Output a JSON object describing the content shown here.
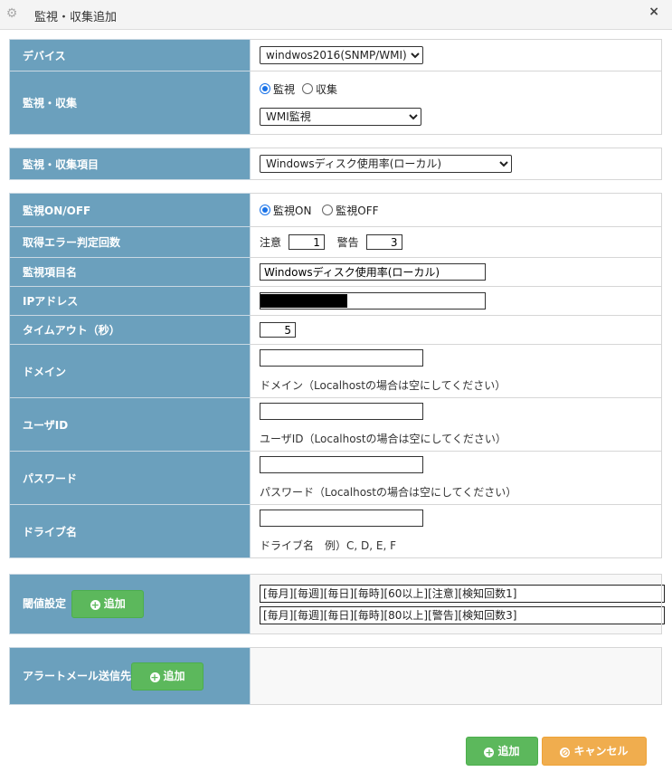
{
  "window": {
    "title": "監視・収集追加",
    "close": "×"
  },
  "device": {
    "label": "デバイス",
    "value": "windwos2016(SNMP/WMI)"
  },
  "monitor_collect": {
    "label": "監視・収集",
    "radio_monitor": "監視",
    "radio_collect": "収集",
    "method": "WMI監視"
  },
  "item": {
    "label": "監視・収集項目",
    "value": "Windowsディスク使用率(ローカル)"
  },
  "onoff": {
    "label": "監視ON/OFF",
    "on": "監視ON",
    "off": "監視OFF"
  },
  "error_count": {
    "label": "取得エラー判定回数",
    "caution_label": "注意",
    "caution_value": "1",
    "warning_label": "警告",
    "warning_value": "3"
  },
  "item_name": {
    "label": "監視項目名",
    "value": "Windowsディスク使用率(ローカル)"
  },
  "ip": {
    "label": "IPアドレス"
  },
  "timeout": {
    "label": "タイムアウト（秒）",
    "value": "5"
  },
  "domain": {
    "label": "ドメイン",
    "value": "",
    "hint": "ドメイン（Localhostの場合は空にしてください）"
  },
  "userid": {
    "label": "ユーザID",
    "value": "",
    "hint": "ユーザID（Localhostの場合は空にしてください）"
  },
  "password": {
    "label": "パスワード",
    "value": "",
    "hint": "パスワード（Localhostの場合は空にしてください）"
  },
  "drive": {
    "label": "ドライブ名",
    "value": "",
    "hint": "ドライブ名　例）C, D, E, F"
  },
  "threshold": {
    "label": "閾値設定",
    "add": "追加",
    "rules": [
      "[毎月][毎週][毎日][毎時][60以上][注意][検知回数1]",
      "[毎月][毎週][毎日][毎時][80以上][警告][検知回数3]"
    ]
  },
  "alert_mail": {
    "label": "アラートメール送信先",
    "add": "追加"
  },
  "footer": {
    "add": "追加",
    "cancel": "キャンセル"
  },
  "colors": {
    "label_bg": "#6ba0bd",
    "green": "#5cb85c",
    "orange": "#f0ad4e"
  },
  "icons": {
    "title": "gear-icon",
    "add": "plus-circle-icon",
    "cancel": "ban-icon"
  }
}
